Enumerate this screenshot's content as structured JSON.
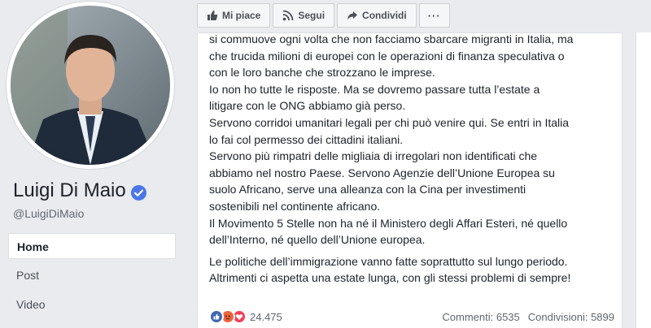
{
  "profile": {
    "name": "Luigi Di Maio",
    "handle": "@LuigiDiMaio"
  },
  "nav": {
    "items": [
      "Home",
      "Post",
      "Video"
    ]
  },
  "toolbar": {
    "like_label": "Mi piace",
    "follow_label": "Segui",
    "share_label": "Condividi",
    "more_label": "···"
  },
  "post": {
    "lines": [
      "si commuove ogni volta che non facciamo sbarcare migranti in Italia, ma",
      "che trucida milioni di europei con le operazioni di finanza speculativa o",
      "con le loro banche che strozzano le imprese.",
      "Io non ho tutte le risposte. Ma se dovremo passare tutta l’estate a",
      "litigare con le ONG abbiamo già perso.",
      "Servono corridoi umanitari legali per chi può venire qui. Se entri in Italia",
      "lo fai col permesso dei cittadini italiani.",
      "Servono più rimpatri delle migliaia di irregolari non identificati che",
      "abbiamo nel nostro Paese. Servono Agenzie dell’Unione Europea su",
      "suolo Africano, serve una alleanza con la Cina per investimenti",
      "sostenibili nel continente africano.",
      "Il Movimento 5 Stelle non ha né il Ministero degli Affari Esteri, né quello",
      "dell’Interno, né quello dell’Unione europea."
    ],
    "closing_lines": [
      "Le politiche dell’immigrazione vanno fatte soprattutto sul lungo periodo.",
      "Altrimenti ci aspetta una estate lunga, con gli stessi problemi di sempre!"
    ],
    "reaction_count": "24.475",
    "comments": "Commenti: 6535",
    "shares": "Condivisioni: 5899"
  },
  "colors": {
    "like_blue": "#4267b2",
    "angry_orange": "#f0643c",
    "love_red": "#f33e58",
    "verified_blue": "#4a76e8"
  }
}
